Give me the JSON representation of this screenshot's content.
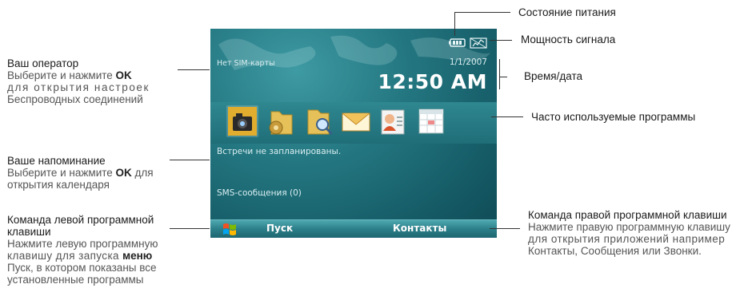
{
  "screen": {
    "operator": "Нет SIM-карты",
    "date": "1/1/2007",
    "time": "12:50 AM",
    "appointments": "Встречи не запланированы.",
    "sms": "SMS-сообщения (0)",
    "left_soft": "Пуск",
    "right_soft": "Контакты",
    "apps": [
      "camera-icon",
      "settings-folder-icon",
      "search-icon",
      "messaging-icon",
      "contacts-icon",
      "calendar-icon"
    ]
  },
  "callouts": {
    "power": "Состояние питания",
    "signal": "Мощность сигнала",
    "datetime": "Время/дата",
    "frequent": "Часто используемые программы",
    "operator_head": "Ваш оператор",
    "operator_sub1a": "Выберите и нажмите ",
    "operator_ok": "OK",
    "operator_sub2": "для открытия настроек",
    "operator_sub3": "Беспроводных соединений",
    "reminder_head": "Ваше напоминание",
    "reminder_sub1a": "Выберите и нажмите ",
    "reminder_ok": "OK",
    "reminder_sub1b": " для",
    "reminder_sub2": "открытия календаря",
    "left_head1": "Команда левой программной",
    "left_head2": "клавиши",
    "left_sub1": "Нажмите левую программную",
    "left_sub2a": "клавишу для запуска ",
    "left_menu": "меню",
    "left_sub3": "Пуск, в котором показаны все",
    "left_sub4": "установленные программы",
    "right_head": "Команда правой программной клавиши",
    "right_sub1": "Нажмите  правую программную клавишу",
    "right_sub2": "для открытия приложений например",
    "right_sub3": "Контакты, Сообщения или Звонки."
  },
  "colors": {
    "screen_teal": "#237680",
    "softbar": "#2c7f89"
  }
}
